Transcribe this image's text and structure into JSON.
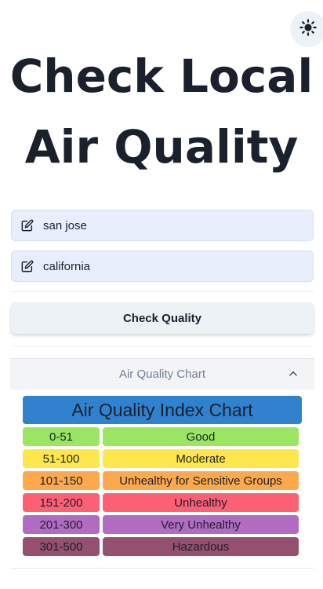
{
  "header": {
    "title": "Check Local Air Quality",
    "theme_toggle_icon": "sun-icon"
  },
  "form": {
    "city_value": "san jose",
    "state_value": "california",
    "field_icon": "edit-icon",
    "submit_label": "Check Quality"
  },
  "accordion": {
    "label": "Air Quality Chart",
    "icon": "chevron-up-icon",
    "expanded": true
  },
  "aqi_chart": {
    "title": "Air Quality Index Chart",
    "title_color": "#3182ce",
    "rows": [
      {
        "range": "0-51",
        "level": "Good",
        "color": "#9ae662"
      },
      {
        "range": "51-100",
        "level": "Moderate",
        "color": "#fde74c"
      },
      {
        "range": "101-150",
        "level": "Unhealthy for Sensitive Groups",
        "color": "#fba94c"
      },
      {
        "range": "151-200",
        "level": "Unhealthy",
        "color": "#fd5f74"
      },
      {
        "range": "201-300",
        "level": "Very Unhealthy",
        "color": "#b16cc2"
      },
      {
        "range": "301-500",
        "level": "Hazardous",
        "color": "#94506e"
      }
    ]
  }
}
